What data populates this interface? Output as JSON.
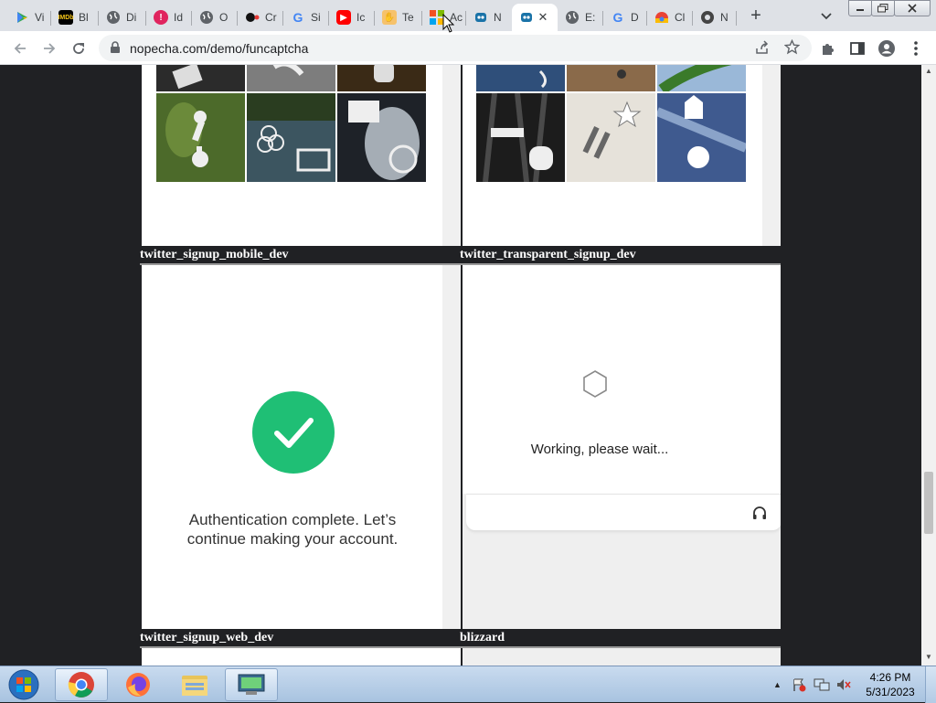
{
  "browser": {
    "tabs": [
      {
        "title": "Vi",
        "icon": "play-store-icon"
      },
      {
        "title": "Bl",
        "icon": "imdb-icon"
      },
      {
        "title": "Di",
        "icon": "globe-icon"
      },
      {
        "title": "Id",
        "icon": "red-circle-icon"
      },
      {
        "title": "O",
        "icon": "globe-icon"
      },
      {
        "title": "Cr",
        "icon": "dots-icon"
      },
      {
        "title": "Si",
        "icon": "google-icon"
      },
      {
        "title": "Ic",
        "icon": "youtube-icon"
      },
      {
        "title": "Te",
        "icon": "hand-icon"
      },
      {
        "title": "Ac",
        "icon": "microsoft-icon"
      },
      {
        "title": "N",
        "icon": "robot-icon"
      },
      {
        "title": "",
        "icon": "robot-icon",
        "active": true
      },
      {
        "title": "E:",
        "icon": "globe-icon"
      },
      {
        "title": "D",
        "icon": "google-icon"
      },
      {
        "title": "Cl",
        "icon": "chrome-web-store-icon"
      },
      {
        "title": "N",
        "icon": "github-icon"
      }
    ],
    "active_tab_close": "✕",
    "new_tab": "+",
    "url": "nopecha.com/demo/funcaptcha"
  },
  "page": {
    "labels": {
      "top_left": "twitter_signup_mobile_dev",
      "top_right": "twitter_transparent_signup_dev",
      "bottom_left": "twitter_signup_web_dev",
      "bottom_right": "blizzard"
    },
    "auth_message": "Authentication complete. Let’s continue making your account.",
    "working_message": "Working, please wait..."
  },
  "taskbar": {
    "time": "4:26 PM",
    "date": "5/31/2023"
  }
}
